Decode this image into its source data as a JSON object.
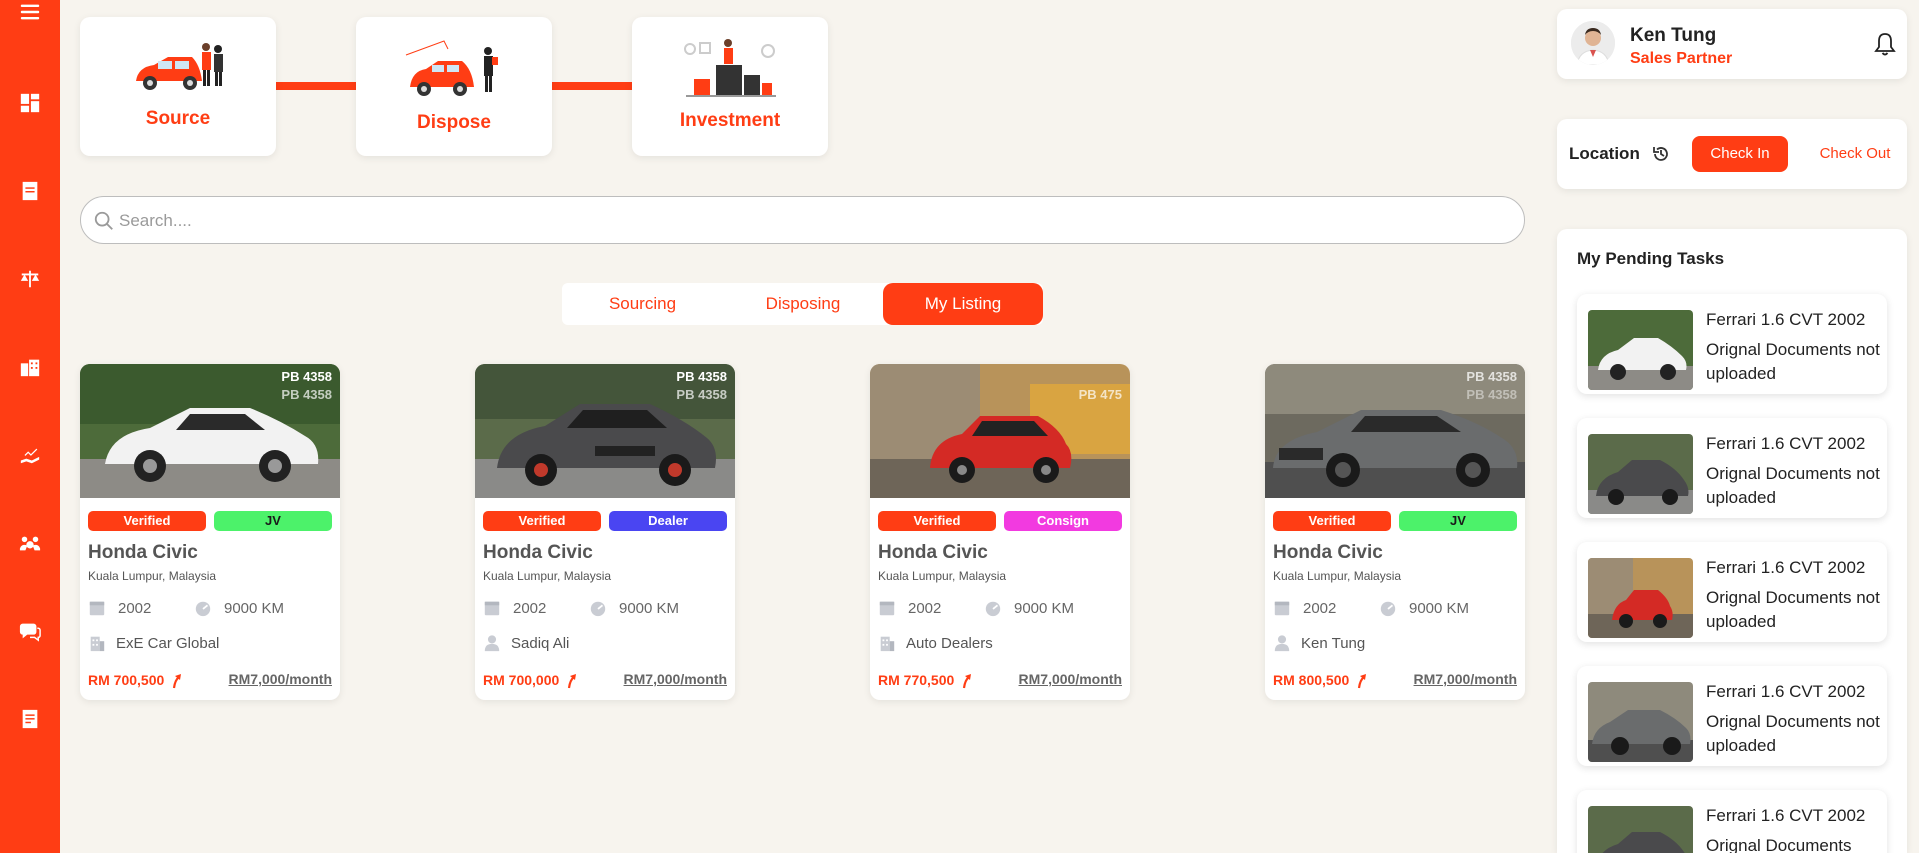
{
  "sidebar": {
    "items": [
      {
        "icon": "menu-icon"
      },
      {
        "icon": "dashboard-icon"
      },
      {
        "icon": "document-icon"
      },
      {
        "icon": "scale-icon"
      },
      {
        "icon": "buildings-icon"
      },
      {
        "icon": "chart-hand-icon"
      },
      {
        "icon": "people-money-icon"
      },
      {
        "icon": "chat-icon"
      },
      {
        "icon": "report-icon"
      }
    ]
  },
  "process": [
    {
      "label": "Source"
    },
    {
      "label": "Dispose"
    },
    {
      "label": "Investment"
    }
  ],
  "search": {
    "placeholder": "Search....",
    "value": ""
  },
  "tabs": [
    {
      "label": "Sourcing",
      "active": false
    },
    {
      "label": "Disposing",
      "active": false
    },
    {
      "label": "My Listing",
      "active": true
    }
  ],
  "listings": [
    {
      "plate": "PB 4358",
      "plate2": "PB 4358",
      "badges": [
        {
          "label": "Verified",
          "color": "#ff3d14"
        },
        {
          "label": "JV",
          "color": "#4cf26a"
        }
      ],
      "title": "Honda Civic",
      "location": "Kuala Lumpur, Malaysia",
      "year": "2002",
      "mileage": "9000 KM",
      "owner": "ExE Car Global",
      "owner_icon": "building-icon",
      "price": "RM 700,500",
      "monthly": "RM7,000/month"
    },
    {
      "plate": "PB 4358",
      "plate2": "PB 4358",
      "badges": [
        {
          "label": "Verified",
          "color": "#ff3d14"
        },
        {
          "label": "Dealer",
          "color": "#4a45f2"
        }
      ],
      "title": "Honda Civic",
      "location": "Kuala Lumpur, Malaysia",
      "year": "2002",
      "mileage": "9000 KM",
      "owner": "Sadiq Ali",
      "owner_icon": "person-icon",
      "price": "RM 700,000",
      "monthly": "RM7,000/month"
    },
    {
      "plate": "",
      "plate2": "PB 475",
      "badges": [
        {
          "label": "Verified",
          "color": "#ff3d14"
        },
        {
          "label": "Consign",
          "color": "#f23ae0"
        }
      ],
      "title": "Honda Civic",
      "location": "Kuala Lumpur, Malaysia",
      "year": "2002",
      "mileage": "9000 KM",
      "owner": "Auto Dealers",
      "owner_icon": "building-icon",
      "price": "RM 770,500",
      "monthly": "RM7,000/month"
    },
    {
      "plate": "PB 4358",
      "plate2": "PB 4358",
      "badges": [
        {
          "label": "Verified",
          "color": "#ff3d14"
        },
        {
          "label": "JV",
          "color": "#4cf26a"
        }
      ],
      "title": "Honda Civic",
      "location": "Kuala Lumpur, Malaysia",
      "year": "2002",
      "mileage": "9000 KM",
      "owner": "Ken Tung",
      "owner_icon": "person-icon",
      "price": "RM 800,500",
      "monthly": "RM7,000/month"
    }
  ],
  "profile": {
    "name": "Ken Tung",
    "role": "Sales Partner"
  },
  "location": {
    "label": "Location",
    "check_in": "Check In",
    "check_out": "Check Out"
  },
  "pending": {
    "title": "My Pending Tasks",
    "tasks": [
      {
        "title": "Ferrari 1.6 CVT 2002",
        "desc": "Orignal Documents not uploaded"
      },
      {
        "title": "Ferrari 1.6 CVT 2002",
        "desc": "Orignal Documents not uploaded"
      },
      {
        "title": "Ferrari 1.6 CVT 2002",
        "desc": "Orignal Documents not uploaded"
      },
      {
        "title": "Ferrari 1.6 CVT 2002",
        "desc": "Orignal Documents not uploaded"
      },
      {
        "title": "Ferrari 1.6 CVT 2002",
        "desc": "Orignal Documents"
      }
    ]
  },
  "colors": {
    "accent": "#ff3d14",
    "background": "#f7f4ee"
  }
}
